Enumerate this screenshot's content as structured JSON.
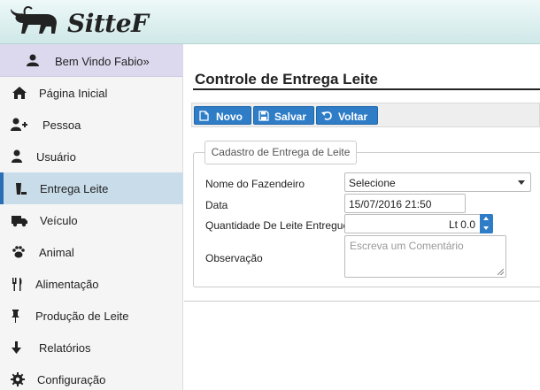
{
  "brand": {
    "name": "SitteF",
    "logo_icon": "bull-icon"
  },
  "sidebar": {
    "welcome": "Bem Vindo Fabio»",
    "items": [
      {
        "label": "Página Inicial",
        "icon": "home-icon"
      },
      {
        "label": "Pessoa",
        "icon": "user-plus-icon"
      },
      {
        "label": "Usuário",
        "icon": "user-icon"
      },
      {
        "label": "Entrega Leite",
        "icon": "bucket-icon",
        "active": true
      },
      {
        "label": "Veículo",
        "icon": "truck-icon"
      },
      {
        "label": "Animal",
        "icon": "paw-icon"
      },
      {
        "label": "Alimentação",
        "icon": "cutlery-icon"
      },
      {
        "label": "Produção de Leite",
        "icon": "pushpin-icon"
      },
      {
        "label": "Relatórios",
        "icon": "arrow-down-icon"
      },
      {
        "label": "Configuração",
        "icon": "gear-icon"
      }
    ]
  },
  "main": {
    "title": "Controle de Entrega Leite",
    "toolbar": {
      "novo": "Novo",
      "salvar": "Salvar",
      "voltar": "Voltar"
    },
    "form": {
      "legend": "Cadastro de Entrega de Leite",
      "fazendeiro_label": "Nome do Fazendeiro",
      "fazendeiro_value": "Selecione",
      "data_label": "Data",
      "data_value": "15/07/2016 21:50",
      "quantidade_label": "Quantidade De Leite Entregue",
      "quantidade_value": "Lt 0.0",
      "observacao_label": "Observação",
      "observacao_placeholder": "Escreva um Comentário"
    }
  },
  "colors": {
    "accent": "#2f7dc7",
    "active_row": "#c9dcea",
    "welcome_bg": "#dcd9ef"
  }
}
